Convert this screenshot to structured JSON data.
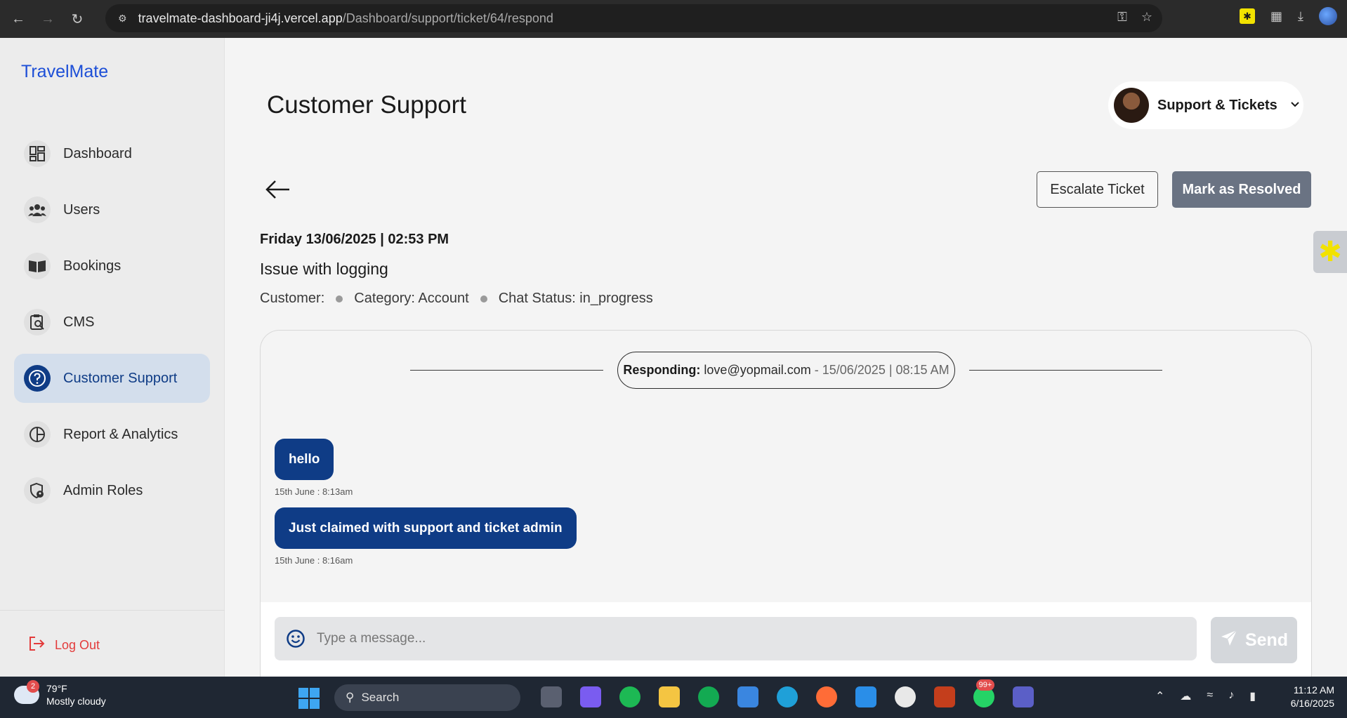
{
  "browser": {
    "url_host": "travelmate-dashboard-ji4j.vercel.app",
    "url_path": "/Dashboard/support/ticket/64/respond",
    "icons": [
      "back-icon",
      "forward-icon",
      "reload-icon",
      "site-info-icon",
      "key-icon",
      "star-icon",
      "extension-icon",
      "puzzle-icon",
      "download-icon",
      "profile-icon"
    ]
  },
  "sidebar": {
    "brand": "TravelMate",
    "items": [
      {
        "label": "Dashboard",
        "icon": "dashboard-icon"
      },
      {
        "label": "Users",
        "icon": "users-icon"
      },
      {
        "label": "Bookings",
        "icon": "book-icon"
      },
      {
        "label": "CMS",
        "icon": "clipboard-icon"
      },
      {
        "label": "Customer Support",
        "icon": "help-icon",
        "active": true
      },
      {
        "label": "Report & Analytics",
        "icon": "pie-chart-icon"
      },
      {
        "label": "Admin Roles",
        "icon": "shield-user-icon"
      }
    ],
    "logout": "Log Out"
  },
  "header": {
    "title": "Customer Support",
    "profile_label": "Support & Tickets"
  },
  "actions": {
    "escalate": "Escalate Ticket",
    "resolve": "Mark as Resolved"
  },
  "ticket": {
    "datetime": "Friday 13/06/2025 | 02:53 PM",
    "subject": "Issue with logging",
    "customer": "Customer:",
    "category": "Category: Account",
    "chat_status": "Chat Status: in_progress"
  },
  "chat": {
    "responding_label": "Responding:",
    "responding_email": "love@yopmail.com",
    "responding_stamp": "- 15/06/2025 | 08:15 AM",
    "messages": [
      {
        "text": "hello",
        "time": "15th June : 8:13am"
      },
      {
        "text": "Just claimed with support and ticket admin",
        "time": "15th June : 8:16am"
      }
    ],
    "input_placeholder": "Type a message...",
    "send_label": "Send"
  },
  "taskbar": {
    "weather_temp": "79°F",
    "weather_desc": "Mostly cloudy",
    "weather_badge": "2",
    "search_label": "Search",
    "whatsapp_badge": "99+",
    "time": "11:12 AM",
    "date": "6/16/2025"
  },
  "colors": {
    "brand": "#1d4fd7",
    "primary": "#0f3c86",
    "active_bg": "#d3deec",
    "logout": "#e33b3b",
    "resolve_btn": "#6a7383"
  }
}
